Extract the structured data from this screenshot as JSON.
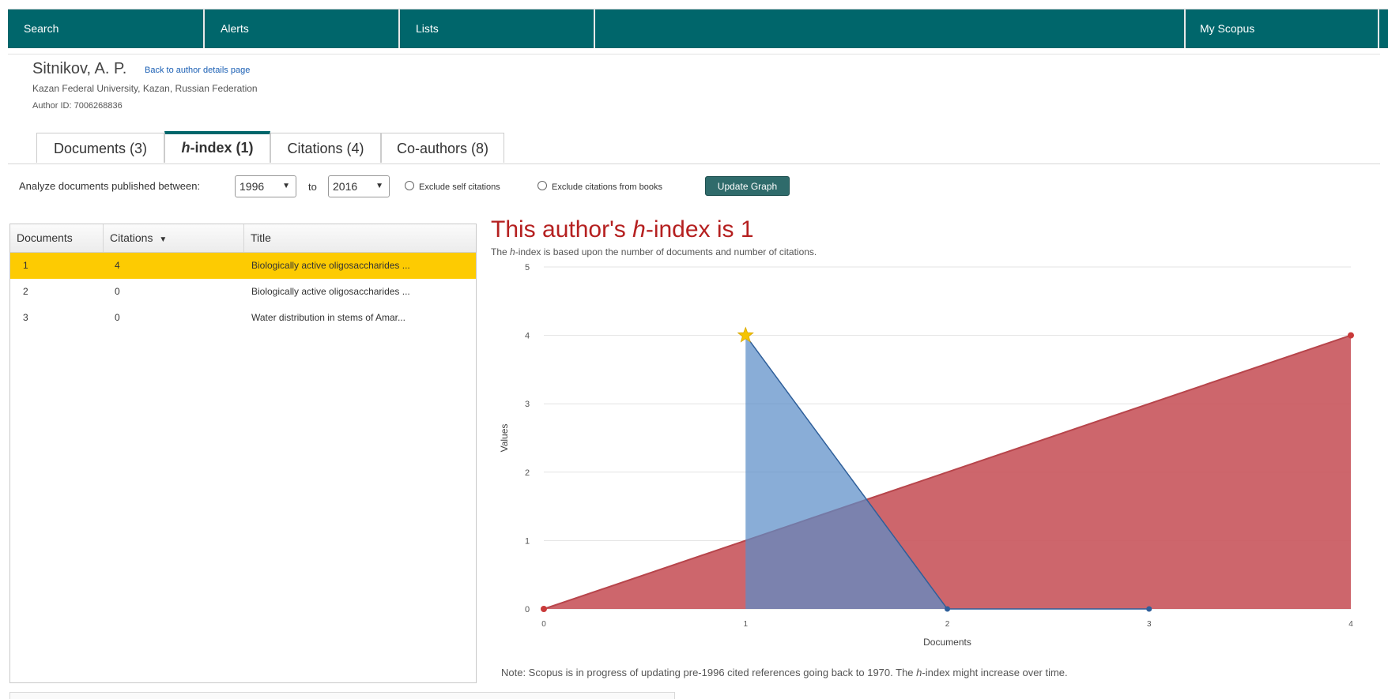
{
  "nav": {
    "search": "Search",
    "alerts": "Alerts",
    "lists": "Lists",
    "my_scopus": "My Scopus"
  },
  "author": {
    "name": "Sitnikov, A. P.",
    "back_link": "Back to author details page",
    "affiliation": "Kazan Federal University, Kazan, Russian Federation",
    "author_id": "Author ID: 7006268836"
  },
  "tabs": {
    "documents": "Documents (3)",
    "hindex_h": "h",
    "hindex_rest": "-index (1)",
    "citations": "Citations (4)",
    "coauthors": "Co-authors (8)"
  },
  "filter": {
    "label": "Analyze documents published between:",
    "from_year": "1996",
    "to_label": "to",
    "to_year": "2016",
    "exclude_self": "Exclude self citations",
    "exclude_books": "Exclude citations from books",
    "update_button": "Update Graph"
  },
  "table": {
    "headers": {
      "documents": "Documents",
      "citations": "Citations",
      "citations_sort_icon": "▼",
      "title": "Title"
    },
    "rows": [
      {
        "doc": "1",
        "citations": "4",
        "title": "Biologically active oligosaccharides ...",
        "selected": true
      },
      {
        "doc": "2",
        "citations": "0",
        "title": "Biologically active oligosaccharides ...",
        "selected": false
      },
      {
        "doc": "3",
        "citations": "0",
        "title": "Water distribution in stems of Amar...",
        "selected": false
      }
    ]
  },
  "chart_header": {
    "title_pre": "This author's ",
    "title_h": "h",
    "title_post": "-index is 1",
    "subtitle_pre": "The ",
    "subtitle_h": "h",
    "subtitle_post": "-index is based upon the number of documents and number of citations.",
    "note_pre": "Note: Scopus is in progress of updating pre-1996 cited references going back to 1970. The ",
    "note_h": "h",
    "note_post": "-index might increase over time."
  },
  "chart_data": {
    "type": "area",
    "xlabel": "Documents",
    "ylabel": "Values",
    "xlim": [
      0,
      4
    ],
    "ylim": [
      0,
      5
    ],
    "x_ticks": [
      "0",
      "1",
      "2",
      "3",
      "4"
    ],
    "y_ticks": [
      "0",
      "1",
      "2",
      "3",
      "4",
      "5"
    ],
    "grid": true,
    "series": [
      {
        "kind": "reference",
        "color": "#c9595f",
        "x": [
          0,
          4
        ],
        "y": [
          0,
          4
        ]
      },
      {
        "kind": "citations",
        "color": "#5b8ec7",
        "x": [
          1,
          2,
          3
        ],
        "y": [
          4,
          0,
          0
        ]
      }
    ],
    "h_index_marker": {
      "x": 1,
      "y": 4,
      "color": "#f5c400"
    }
  }
}
